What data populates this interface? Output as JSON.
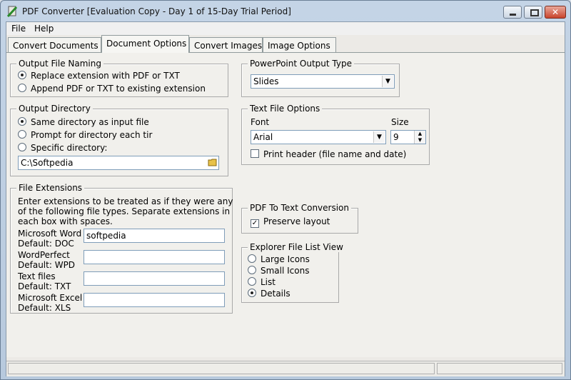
{
  "window": {
    "title": "PDF Converter [Evaluation Copy - Day 1 of 15-Day Trial Period]"
  },
  "menu": [
    "File",
    "Help"
  ],
  "tabs": [
    "Convert Documents",
    "Document Options",
    "Convert Images",
    "Image Options"
  ],
  "active_tab": "Document Options",
  "output_file_naming": {
    "legend": "Output File Naming",
    "options": [
      "Replace extension with PDF or TXT",
      "Append PDF or TXT to existing extension"
    ],
    "selected": "Replace extension with PDF or TXT"
  },
  "output_directory": {
    "legend": "Output Directory",
    "options": [
      "Same directory as input file",
      "Prompt for directory each tir",
      "Specific directory:"
    ],
    "selected": "Same directory as input file",
    "path_value": "C:\\Softpedia"
  },
  "file_extensions": {
    "legend": "File Extensions",
    "description": [
      "Enter extensions to be treated as if they were any",
      "of the following file types. Separate extensions in",
      "each box with spaces."
    ],
    "rows": [
      {
        "name": "Microsoft Word",
        "default": "Default: DOC",
        "value": "softpedia"
      },
      {
        "name": "WordPerfect",
        "default": "Default: WPD",
        "value": ""
      },
      {
        "name": "Text files",
        "default": "Default: TXT",
        "value": ""
      },
      {
        "name": "Microsoft Excel",
        "default": "Default: XLS",
        "value": ""
      }
    ]
  },
  "powerpoint_output": {
    "legend": "PowerPoint Output Type",
    "value": "Slides"
  },
  "text_file_options": {
    "legend": "Text File Options",
    "font_label": "Font",
    "font_value": "Arial",
    "size_label": "Size",
    "size_value": "9",
    "print_header_label": "Print header (file name and date)",
    "print_header_checked": false
  },
  "pdf_to_text": {
    "legend": "PDF To Text Conversion",
    "preserve_label": "Preserve layout",
    "preserve_checked": true
  },
  "explorer_view": {
    "legend": "Explorer File List View",
    "options": [
      "Large Icons",
      "Small Icons",
      "List",
      "Details"
    ],
    "selected": "Details"
  },
  "icons": {
    "app": "app-icon",
    "folder": "folder-icon",
    "dropdown": "chevron-down-icon"
  }
}
